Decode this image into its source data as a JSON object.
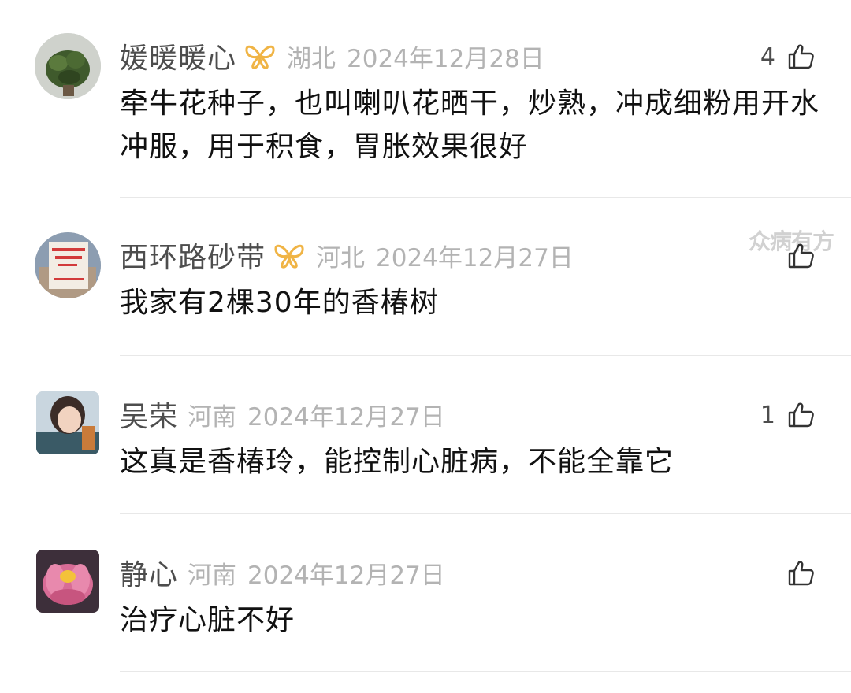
{
  "comments": [
    {
      "username": "媛暖暖心",
      "has_badge": true,
      "location": "湖北",
      "date": "2024年12月28日",
      "likes": "4",
      "text": "牵牛花种子，也叫喇叭花晒干，炒熟，冲成细粉用开水冲服，用于积食，胃胀效果很好"
    },
    {
      "username": "西环路砂带",
      "has_badge": true,
      "location": "河北",
      "date": "2024年12月27日",
      "likes": "",
      "text": "我家有2棵30年的香椿树"
    },
    {
      "username": "吴荣",
      "has_badge": false,
      "location": "河南",
      "date": "2024年12月27日",
      "likes": "1",
      "text": "这真是香椿玲，能控制心脏病，不能全靠它"
    },
    {
      "username": "静心",
      "has_badge": false,
      "location": "河南",
      "date": "2024年12月27日",
      "likes": "",
      "text": "治疗心脏不好"
    }
  ],
  "watermark": "众病有方",
  "icons": {
    "badge": "fan-badge-icon",
    "like": "thumbs-up-icon"
  },
  "colors": {
    "username": "#4d4d4d",
    "meta": "#b3b3b3",
    "text": "#111111",
    "badge": "#f0b445",
    "divider": "#e8e8e8"
  }
}
